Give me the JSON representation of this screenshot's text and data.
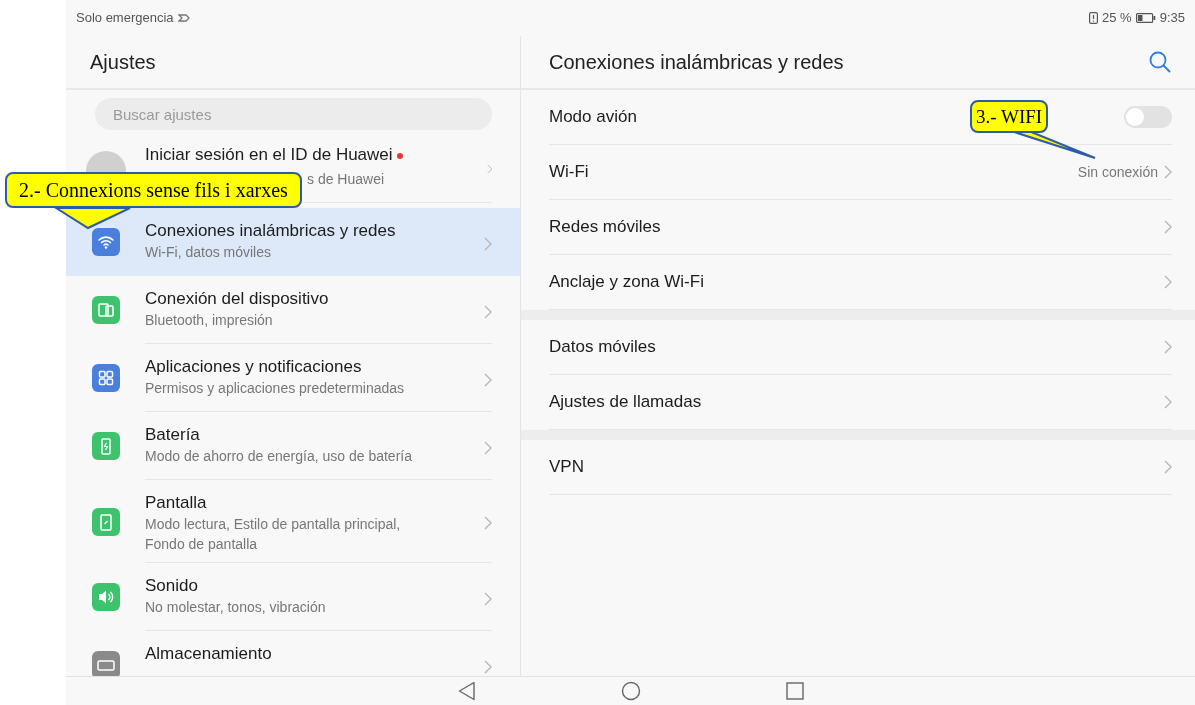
{
  "status_bar": {
    "carrier": "Solo emergencia",
    "battery_percent": "25 %",
    "time": "9:35"
  },
  "settings": {
    "title": "Ajustes",
    "search": {
      "placeholder": "Buscar ajustes"
    },
    "items": [
      {
        "kind": "account",
        "title": "Iniciar sesión en el ID de Huawei",
        "subtitle": "s de Huawei",
        "notification_dot": true,
        "selected": false
      },
      {
        "kind": "category",
        "title": "Conexiones inalámbricas y redes",
        "subtitle": "Wi-Fi, datos móviles",
        "color": "#4a80dc",
        "selected": true
      },
      {
        "kind": "category",
        "title": "Conexión del dispositivo",
        "subtitle": "Bluetooth, impresión",
        "color": "#3fc26e",
        "selected": false
      },
      {
        "kind": "category",
        "title": "Aplicaciones y notificaciones",
        "subtitle": "Permisos y aplicaciones predeterminadas",
        "color": "#4a80dc",
        "selected": false
      },
      {
        "kind": "category",
        "title": "Batería",
        "subtitle": "Modo de ahorro de energía, uso de batería",
        "color": "#3fc26e",
        "selected": false
      },
      {
        "kind": "category",
        "title": "Pantalla",
        "subtitle": "Modo lectura, Estilo de pantalla principal, Fondo de pantalla",
        "color": "#3fc26e",
        "selected": false
      },
      {
        "kind": "category",
        "title": "Sonido",
        "subtitle": "No molestar, tonos, vibración",
        "color": "#3fc26e",
        "selected": false
      },
      {
        "kind": "category",
        "title": "Almacenamiento",
        "color": "#8a8a8a",
        "selected": false
      }
    ]
  },
  "detail": {
    "title": "Conexiones inalámbricas y redes",
    "groups": [
      [
        {
          "kind": "toggle",
          "label": "Modo avión",
          "on": false
        },
        {
          "kind": "link",
          "label": "Wi-Fi",
          "value": "Sin conexión"
        },
        {
          "kind": "link",
          "label": "Redes móviles"
        },
        {
          "kind": "link",
          "label": "Anclaje y zona Wi-Fi"
        }
      ],
      [
        {
          "kind": "link",
          "label": "Datos móviles"
        },
        {
          "kind": "link",
          "label": "Ajustes de llamadas"
        }
      ],
      [
        {
          "kind": "link",
          "label": "VPN"
        }
      ]
    ]
  },
  "annotations": [
    {
      "text": "2.- Connexions sense fils i xarxes"
    },
    {
      "text": "3.- WIFI"
    }
  ]
}
